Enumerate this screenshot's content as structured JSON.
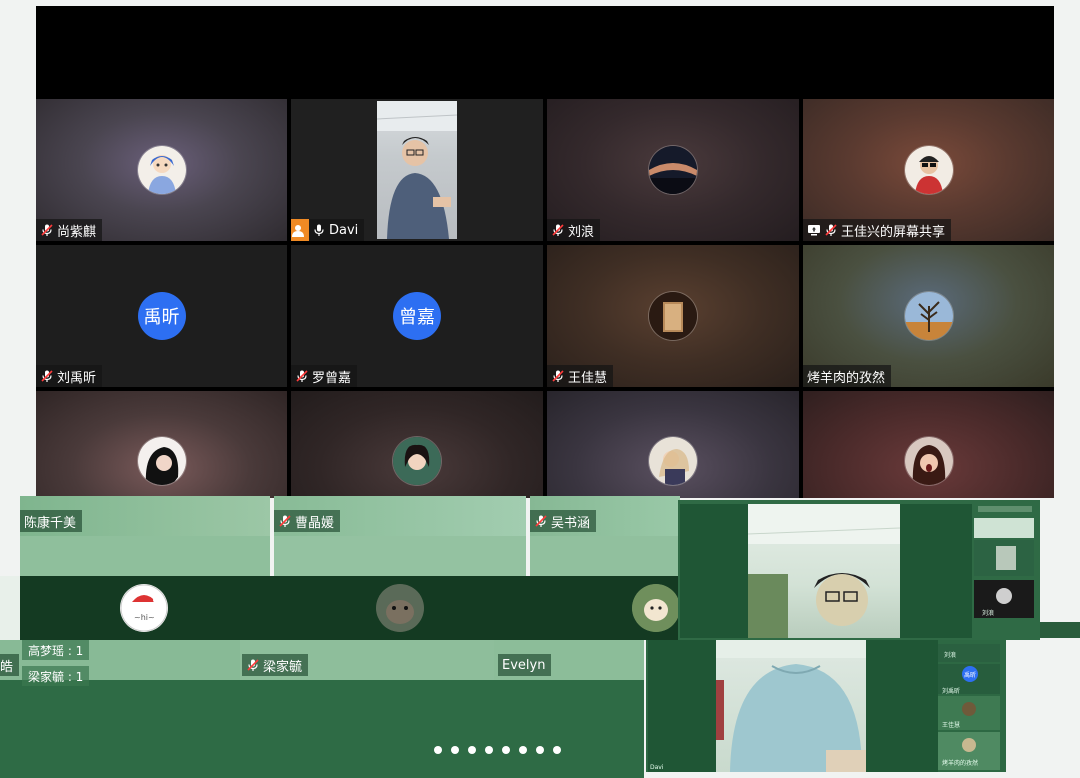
{
  "gallery": {
    "tiles": [
      {
        "name": "尚紫麒",
        "mic": "muted"
      },
      {
        "name": "Davi",
        "mic": "on",
        "active": true
      },
      {
        "name": "刘浪",
        "mic": "muted"
      },
      {
        "name": "王佳兴的屏幕共享",
        "mic": "muted",
        "sharing": true
      },
      {
        "name": "刘禹昕",
        "mic": "muted",
        "initials": "禹昕"
      },
      {
        "name": "罗曾嘉",
        "mic": "muted",
        "initials": "曾嘉"
      },
      {
        "name": "王佳慧",
        "mic": "muted"
      },
      {
        "name": "烤羊肉的孜然",
        "mic": "none"
      }
    ]
  },
  "green_gallery": {
    "labels": [
      {
        "name": "陈康千美",
        "mic": "none"
      },
      {
        "name": "曹晶媛",
        "mic": "muted"
      },
      {
        "name": "吴书涵",
        "mic": "muted"
      },
      {
        "name": "梁家毓",
        "mic": "muted"
      },
      {
        "name": "Evelyn",
        "mic": "none"
      },
      {
        "name": "皓",
        "mic": "none"
      }
    ],
    "poll": [
      {
        "text": "高梦瑶 : 1"
      },
      {
        "text": "梁家毓 : 1"
      }
    ],
    "page_dots": 8
  },
  "mini_sidebar": {
    "labels": [
      "刘浪",
      "刘禹昕",
      "王佳慧",
      "烤羊肉的孜然"
    ],
    "badge": "禹昕",
    "bottom_name": "Davi"
  },
  "colors": {
    "active_border": "#2fbf5b",
    "initials_bg": "#2d6ff2",
    "green_overlay": "#2e6b45",
    "badge_orange": "#f08a24"
  }
}
